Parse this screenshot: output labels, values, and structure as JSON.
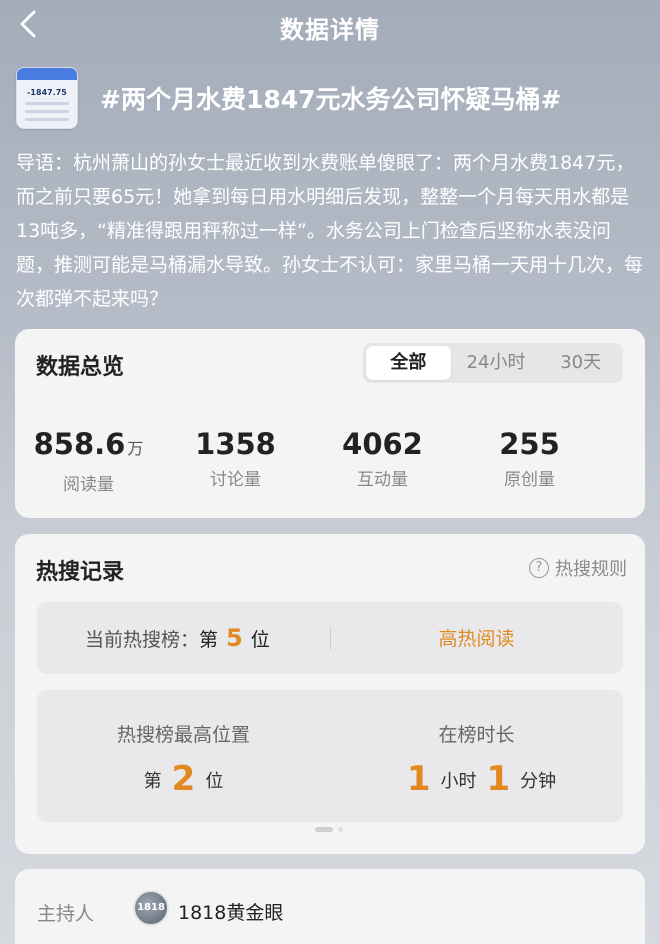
{
  "nav": {
    "title": "数据详情"
  },
  "topic": {
    "thumb_text": "-1847.75",
    "title": "#两个月水费1847元水务公司怀疑马桶#",
    "intro": "导语：杭州萧山的孙女士最近收到水费账单傻眼了：两个月水费1847元，而之前只要65元！她拿到每日用水明细后发现，整整一个月每天用水都是13吨多，“精准得跟用秤称过一样”。水务公司上门检查后坚称水表没问题，推测可能是马桶漏水导致。孙女士不认可：家里马桶一天用十几次，每次都弹不起来吗？"
  },
  "overview": {
    "title": "数据总览",
    "tabs": [
      "全部",
      "24小时",
      "30天"
    ],
    "active_tab": "全部",
    "stats": [
      {
        "value": "858.6",
        "unit": "万",
        "label": "阅读量"
      },
      {
        "value": "1358",
        "unit": "",
        "label": "讨论量"
      },
      {
        "value": "4062",
        "unit": "",
        "label": "互动量"
      },
      {
        "value": "255",
        "unit": "",
        "label": "原创量"
      }
    ]
  },
  "hot": {
    "title": "热搜记录",
    "rule_label": "热搜规则",
    "current_label": "当前热搜榜：",
    "current_prefix": "第",
    "current_rank": "5",
    "current_suffix": "位",
    "hot_read": "高热阅读",
    "best_label": "热搜榜最高位置",
    "best_prefix": "第",
    "best_rank": "2",
    "best_suffix": "位",
    "duration_label": "在榜时长",
    "duration_hours": "1",
    "hours_unit": "小时",
    "duration_minutes": "1",
    "minutes_unit": "分钟"
  },
  "host": {
    "label": "主持人",
    "avatar_text": "1818",
    "name": "1818黄金眼"
  },
  "colors": {
    "accent": "#e28a22",
    "card": "#f4f4f5"
  },
  "icons": {
    "back": "chevron-left-icon",
    "help": "question-circle-icon"
  }
}
